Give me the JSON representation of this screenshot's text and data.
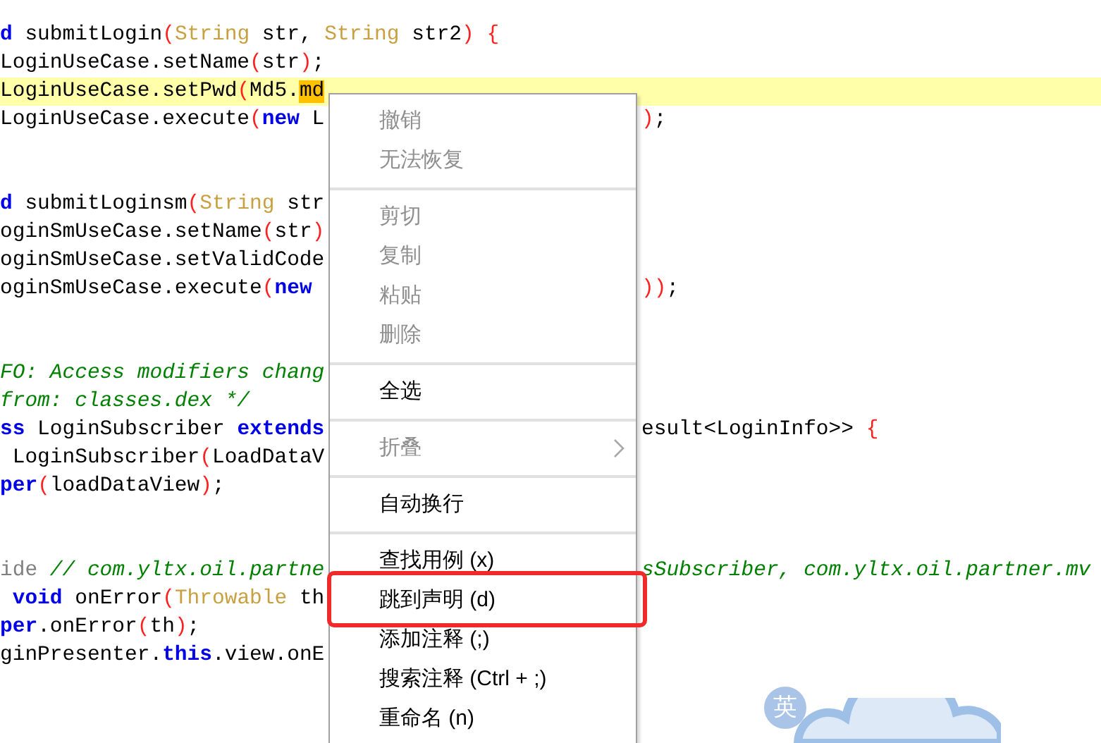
{
  "editor": {
    "lines": [
      {
        "kind": "code",
        "current": false,
        "left": [
          {
            "kind": "kw",
            "t": "d"
          },
          {
            "kind": "p",
            "t": " submitLogin"
          },
          {
            "kind": "br",
            "t": "("
          },
          {
            "kind": "ty",
            "t": "String"
          },
          {
            "kind": "p",
            "t": " str, "
          },
          {
            "kind": "ty",
            "t": "String"
          },
          {
            "kind": "p",
            "t": " str2"
          },
          {
            "kind": "br",
            "t": ") {"
          }
        ]
      },
      {
        "kind": "code",
        "current": false,
        "left": [
          {
            "kind": "p",
            "t": "LoginUseCase.setName"
          },
          {
            "kind": "br",
            "t": "("
          },
          {
            "kind": "p",
            "t": "str"
          },
          {
            "kind": "br",
            "t": ")"
          },
          {
            "kind": "p",
            "t": ";"
          }
        ]
      },
      {
        "kind": "code",
        "current": true,
        "left": [
          {
            "kind": "p",
            "t": "LoginUseCase.setPwd"
          },
          {
            "kind": "br",
            "t": "("
          },
          {
            "kind": "p",
            "t": "Md5."
          },
          {
            "kind": "hl",
            "t": "md"
          }
        ]
      },
      {
        "kind": "code",
        "current": false,
        "left": [
          {
            "kind": "p",
            "t": "LoginUseCase.execute"
          },
          {
            "kind": "br",
            "t": "("
          },
          {
            "kind": "kw",
            "t": "new"
          },
          {
            "kind": "p",
            "t": " L"
          }
        ],
        "right": [
          {
            "kind": "br",
            "t": ")"
          },
          {
            "kind": "p",
            "t": ";"
          }
        ]
      },
      {
        "kind": "blank"
      },
      {
        "kind": "blank"
      },
      {
        "kind": "code",
        "current": false,
        "left": [
          {
            "kind": "kw",
            "t": "d"
          },
          {
            "kind": "p",
            "t": " submitLoginsm"
          },
          {
            "kind": "br",
            "t": "("
          },
          {
            "kind": "ty",
            "t": "String"
          },
          {
            "kind": "p",
            "t": " str"
          }
        ]
      },
      {
        "kind": "code",
        "current": false,
        "left": [
          {
            "kind": "p",
            "t": "oginSmUseCase.setName"
          },
          {
            "kind": "br",
            "t": "("
          },
          {
            "kind": "p",
            "t": "str"
          },
          {
            "kind": "br",
            "t": ")"
          }
        ]
      },
      {
        "kind": "code",
        "current": false,
        "left": [
          {
            "kind": "p",
            "t": "oginSmUseCase.setValidCode"
          }
        ]
      },
      {
        "kind": "code",
        "current": false,
        "left": [
          {
            "kind": "p",
            "t": "oginSmUseCase.execute"
          },
          {
            "kind": "br",
            "t": "("
          },
          {
            "kind": "kw",
            "t": "new"
          }
        ],
        "right": [
          {
            "kind": "br",
            "t": "))"
          },
          {
            "kind": "p",
            "t": ";"
          }
        ]
      },
      {
        "kind": "blank"
      },
      {
        "kind": "blank"
      },
      {
        "kind": "code",
        "current": false,
        "left": [
          {
            "kind": "cm",
            "t": "FO: Access modifiers chang"
          }
        ]
      },
      {
        "kind": "code",
        "current": false,
        "left": [
          {
            "kind": "cm",
            "t": "from: classes.dex */"
          }
        ]
      },
      {
        "kind": "code",
        "current": false,
        "left": [
          {
            "kind": "kw",
            "t": "ss"
          },
          {
            "kind": "p",
            "t": " LoginSubscriber "
          },
          {
            "kind": "kw",
            "t": "extends"
          }
        ],
        "right": [
          {
            "kind": "p",
            "t": "esult<LoginInfo>> "
          },
          {
            "kind": "br",
            "t": "{"
          }
        ]
      },
      {
        "kind": "code",
        "current": false,
        "left": [
          {
            "kind": "p",
            "t": " LoginSubscriber"
          },
          {
            "kind": "br",
            "t": "("
          },
          {
            "kind": "p",
            "t": "LoadDataV"
          }
        ]
      },
      {
        "kind": "code",
        "current": false,
        "left": [
          {
            "kind": "kw",
            "t": "per"
          },
          {
            "kind": "br",
            "t": "("
          },
          {
            "kind": "p",
            "t": "loadDataView"
          },
          {
            "kind": "br",
            "t": ")"
          },
          {
            "kind": "p",
            "t": ";"
          }
        ]
      },
      {
        "kind": "blank"
      },
      {
        "kind": "blank"
      },
      {
        "kind": "code",
        "current": false,
        "left": [
          {
            "kind": "an",
            "t": "ide "
          },
          {
            "kind": "cm",
            "t": "// com.yltx.oil.partne"
          }
        ],
        "right": [
          {
            "kind": "cm",
            "t": "sSubscriber, com.yltx.oil.partner.mv"
          }
        ]
      },
      {
        "kind": "code",
        "current": false,
        "left": [
          {
            "kind": "kw",
            "t": " void"
          },
          {
            "kind": "p",
            "t": " onError"
          },
          {
            "kind": "br",
            "t": "("
          },
          {
            "kind": "ty",
            "t": "Throwable"
          },
          {
            "kind": "p",
            "t": " th"
          }
        ]
      },
      {
        "kind": "code",
        "current": false,
        "left": [
          {
            "kind": "kw",
            "t": "per"
          },
          {
            "kind": "p",
            "t": ".onError"
          },
          {
            "kind": "br",
            "t": "("
          },
          {
            "kind": "p",
            "t": "th"
          },
          {
            "kind": "br",
            "t": ")"
          },
          {
            "kind": "p",
            "t": ";"
          }
        ]
      },
      {
        "kind": "code",
        "current": false,
        "left": [
          {
            "kind": "p",
            "t": "ginPresenter."
          },
          {
            "kind": "kw",
            "t": "this"
          },
          {
            "kind": "p",
            "t": ".view.onE"
          }
        ]
      }
    ]
  },
  "context_menu": {
    "items": [
      {
        "kind": "item",
        "label": "撤销",
        "disabled": true,
        "submenu": false
      },
      {
        "kind": "item",
        "label": "无法恢复",
        "disabled": true,
        "submenu": false
      },
      {
        "kind": "separator"
      },
      {
        "kind": "item",
        "label": "剪切",
        "disabled": true,
        "submenu": false
      },
      {
        "kind": "item",
        "label": "复制",
        "disabled": true,
        "submenu": false
      },
      {
        "kind": "item",
        "label": "粘贴",
        "disabled": true,
        "submenu": false
      },
      {
        "kind": "item",
        "label": "删除",
        "disabled": true,
        "submenu": false
      },
      {
        "kind": "separator"
      },
      {
        "kind": "item",
        "label": "全选",
        "disabled": false,
        "submenu": false
      },
      {
        "kind": "separator"
      },
      {
        "kind": "item",
        "label": "折叠",
        "disabled": true,
        "submenu": true
      },
      {
        "kind": "separator"
      },
      {
        "kind": "item",
        "label": "自动换行",
        "disabled": false,
        "submenu": false
      },
      {
        "kind": "separator"
      },
      {
        "kind": "item",
        "label": "查找用例 (x)",
        "disabled": false,
        "submenu": false
      },
      {
        "kind": "item",
        "label": "跳到声明 (d)",
        "disabled": false,
        "submenu": false,
        "circled": true
      },
      {
        "kind": "item",
        "label": "添加注释 (;)",
        "disabled": false,
        "submenu": false
      },
      {
        "kind": "item",
        "label": "搜索注释 (Ctrl + ;)",
        "disabled": false,
        "submenu": false
      },
      {
        "kind": "item",
        "label": "重命名 (n)",
        "disabled": false,
        "submenu": false
      }
    ]
  },
  "input_method": {
    "label": "英"
  }
}
